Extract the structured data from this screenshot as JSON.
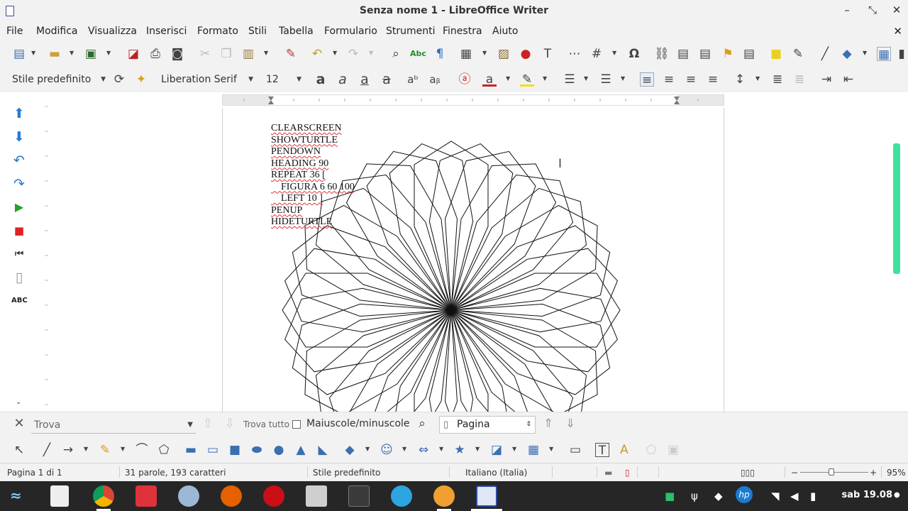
{
  "window": {
    "title": "Senza nome 1 - LibreOffice Writer"
  },
  "menu": {
    "items": [
      "File",
      "Modifica",
      "Visualizza",
      "Inserisci",
      "Formato",
      "Stili",
      "Tabella",
      "Formulario",
      "Strumenti",
      "Finestra",
      "Aiuto"
    ]
  },
  "format_toolbar": {
    "paragraph_style": "Stile predefinito",
    "font_name": "Liberation Serif",
    "font_size": "12"
  },
  "document": {
    "lines": [
      "CLEARSCREEN",
      "SHOWTURTLE",
      "PENDOWN",
      "HEADING 90",
      "REPEAT 36 [",
      "    FIGURA 6 60 100",
      "    LEFT 10 ]",
      "PENUP",
      "HIDETURTLE"
    ]
  },
  "findbar": {
    "placeholder": "Trova",
    "find_all": "Trova tutto",
    "match_case": "Maiuscole/minuscole",
    "search_scope": "Pagina"
  },
  "statusbar": {
    "page": "Pagina 1 di 1",
    "words": "31 parole, 193 caratteri",
    "style": "Stile predefinito",
    "language": "Italiano (Italia)",
    "zoom": "95%"
  },
  "taskbar": {
    "clock": "sab 19.08"
  },
  "colors": {
    "accent_scroll": "#3fe1a0",
    "taskbar_bg": "#262626",
    "toolbar_bg": "#f2f2f2"
  },
  "icons": {
    "left_sidebar": [
      "arrow-up-icon",
      "arrow-down-icon",
      "undo-icon",
      "redo-icon",
      "run-icon",
      "stop-icon",
      "restart-icon",
      "document-icon",
      "spellcheck-icon"
    ]
  }
}
